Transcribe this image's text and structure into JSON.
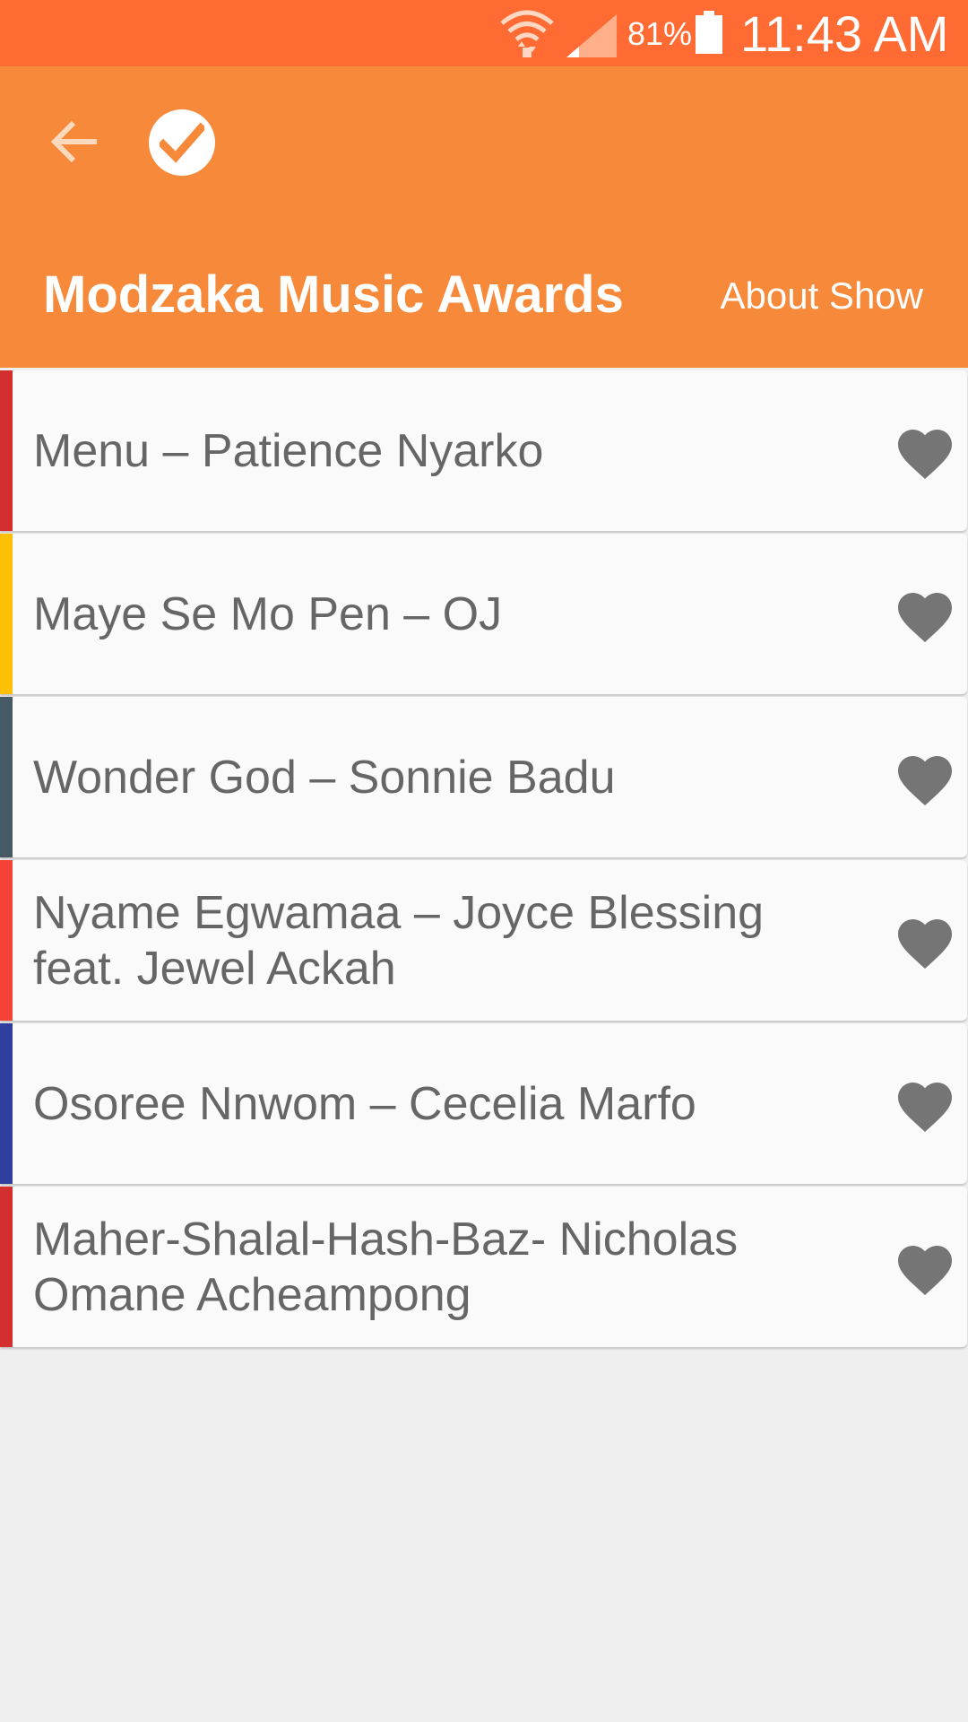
{
  "status_bar": {
    "battery_percent": "81%",
    "time": "11:43 AM",
    "icons": [
      "wifi-icon",
      "signal-icon",
      "battery-icon"
    ]
  },
  "app_bar": {
    "title": "Modzaka Music Awards",
    "about_label": "About Show",
    "background_color": "#f6893a",
    "status_color": "#ff6b33"
  },
  "songs": [
    {
      "title": "Menu – Patience Nyarko",
      "accent": "#d32f2f",
      "icon": "heart-icon"
    },
    {
      "title": "Maye Se Mo Pen – OJ",
      "accent": "#ffc107",
      "icon": "heart-icon"
    },
    {
      "title": "Wonder God – Sonnie Badu",
      "accent": "#455a64",
      "icon": "heart-icon"
    },
    {
      "title": "Nyame Egwamaa – Joyce Blessing feat. Jewel Ackah",
      "accent": "#f44336",
      "icon": "heart-icon"
    },
    {
      "title": "Osoree Nnwom – Cecelia Marfo",
      "accent": "#303f9f",
      "icon": "heart-icon"
    },
    {
      "title": "Maher-Shalal-Hash-Baz- Nicholas Omane Acheampong",
      "accent": "#d32f2f",
      "icon": "heart-icon"
    }
  ]
}
